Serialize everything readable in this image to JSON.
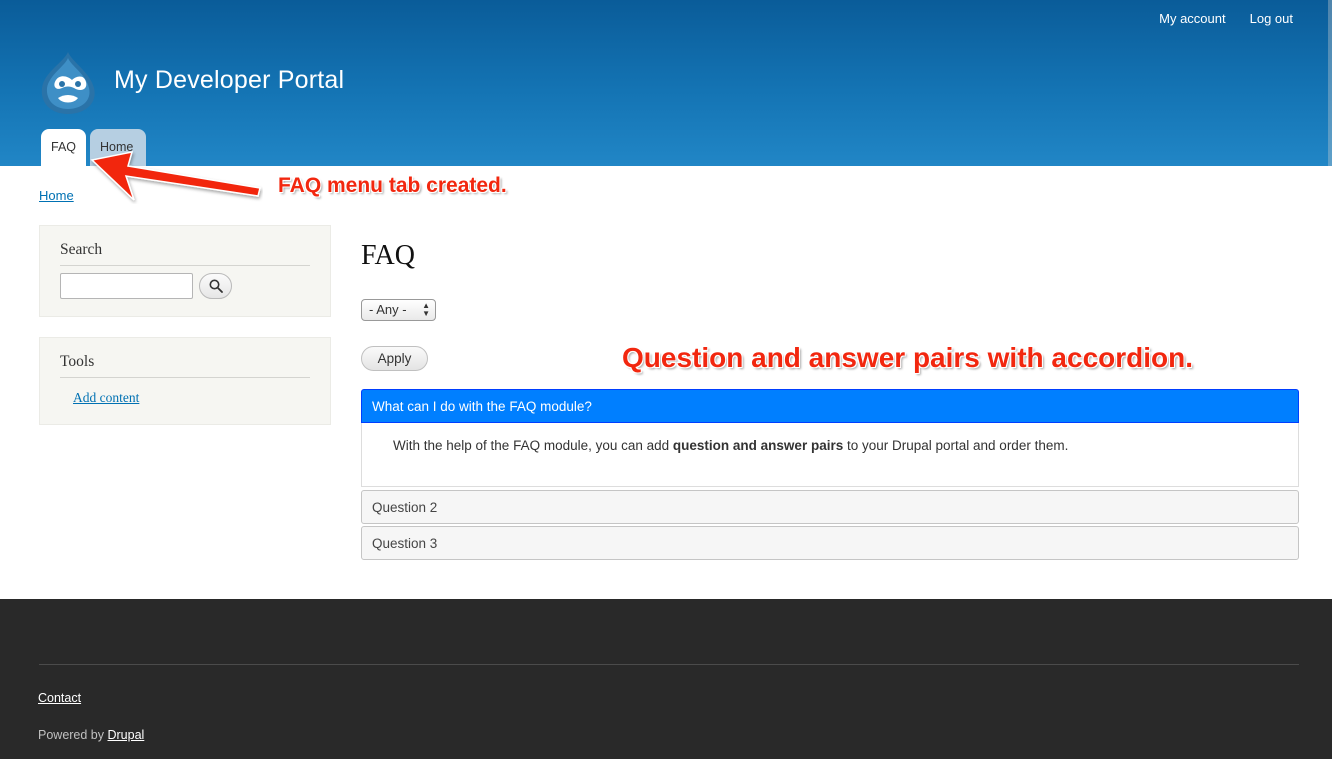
{
  "header": {
    "site_name": "My Developer Portal",
    "secondary_menu": [
      "My account",
      "Log out"
    ],
    "tabs": [
      {
        "label": "FAQ",
        "active": true
      },
      {
        "label": "Home",
        "active": false
      }
    ],
    "logo_icon": "drupal-drop-icon"
  },
  "breadcrumb": {
    "home": "Home"
  },
  "sidebar": {
    "search": {
      "title": "Search",
      "input_value": "",
      "button_icon": "search-icon"
    },
    "tools": {
      "title": "Tools",
      "add_content": "Add content"
    }
  },
  "main": {
    "title": "FAQ",
    "filter": {
      "selected": "- Any -"
    },
    "apply_label": "Apply",
    "faq": [
      {
        "question": "What can I do with the FAQ module?",
        "expanded": true,
        "answer_pre": "With the help of the FAQ module, you can add ",
        "answer_bold": "question and answer pairs",
        "answer_post": " to your Drupal portal and order them."
      },
      {
        "question": "Question 2",
        "expanded": false
      },
      {
        "question": "Question 3",
        "expanded": false
      }
    ]
  },
  "annotations": {
    "tab_note": "FAQ menu tab created.",
    "accordion_note": "Question and answer pairs with accordion."
  },
  "footer": {
    "contact": "Contact",
    "powered_by": "Powered by ",
    "powered_link": "Drupal"
  },
  "colors": {
    "header_top": "#0a5c99",
    "header_bottom": "#2186c6",
    "accordion_active": "#007fff",
    "annotation": "#f2270f",
    "footer_bg": "#292929",
    "link": "#0071b3"
  }
}
